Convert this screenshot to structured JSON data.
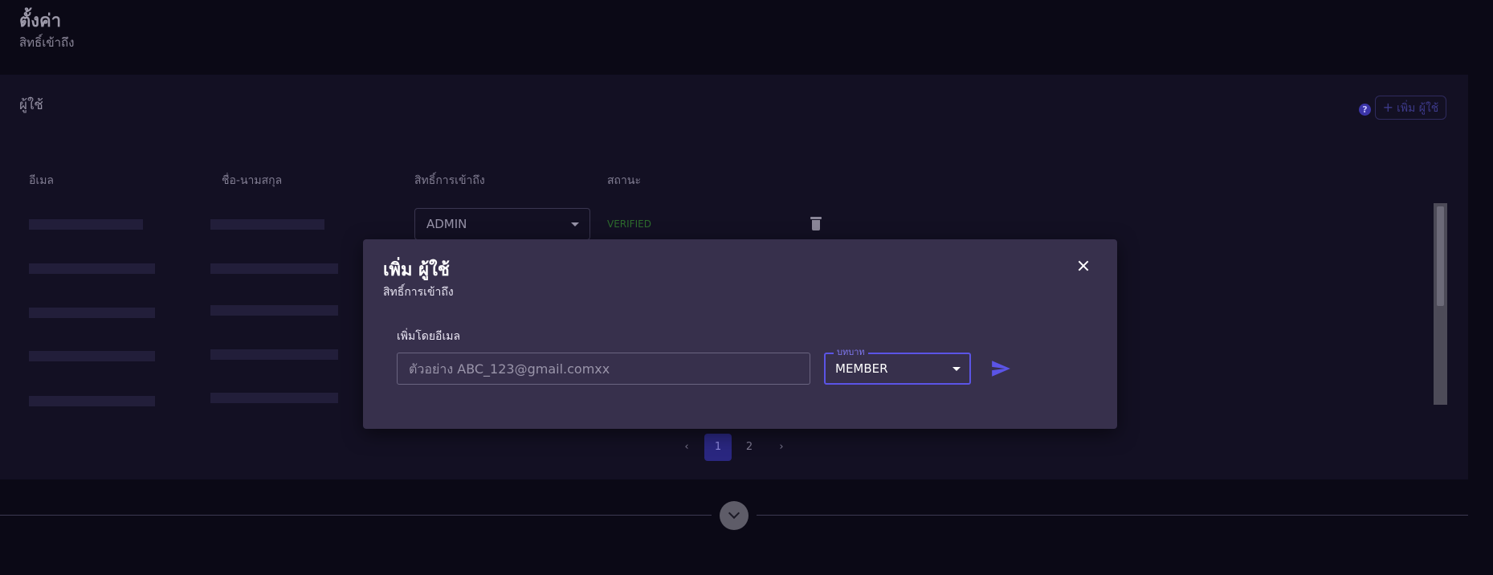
{
  "page": {
    "title": "ตั้งค่า",
    "subtitle": "สิทธิ์เข้าถึง"
  },
  "users_panel": {
    "title": "ผู้ใช้",
    "help_icon": "?",
    "add_user_label": "เพิ่ม ผู้ใช้",
    "columns": [
      "อีเมล",
      "ชื่อ-นามสกุล",
      "สิทธิ์การเข้าถึง",
      "สถานะ"
    ],
    "first_row": {
      "role": "ADMIN",
      "status": "VERIFIED"
    },
    "pagination": {
      "pages": [
        "1",
        "2"
      ],
      "current": "1"
    }
  },
  "modal": {
    "title": "เพิ่ม ผู้ใช้",
    "subtitle": "สิทธิ์การเข้าถึง",
    "email_label": "เพิ่มโดยอีเมล",
    "email_placeholder": "ตัวอย่าง ABC_123@gmail.comxx",
    "role_label": "บทบาท",
    "role_value": "MEMBER"
  },
  "colors": {
    "background": "#0b0916",
    "panel": "#131023",
    "modal": "#37304c",
    "accent": "#5b54e6",
    "verified": "#2d6b2d"
  },
  "icons": [
    "help-icon",
    "plus-icon",
    "trash-icon",
    "close-icon",
    "send-icon",
    "chevron-down-icon",
    "chevron-left-icon",
    "chevron-right-icon"
  ]
}
